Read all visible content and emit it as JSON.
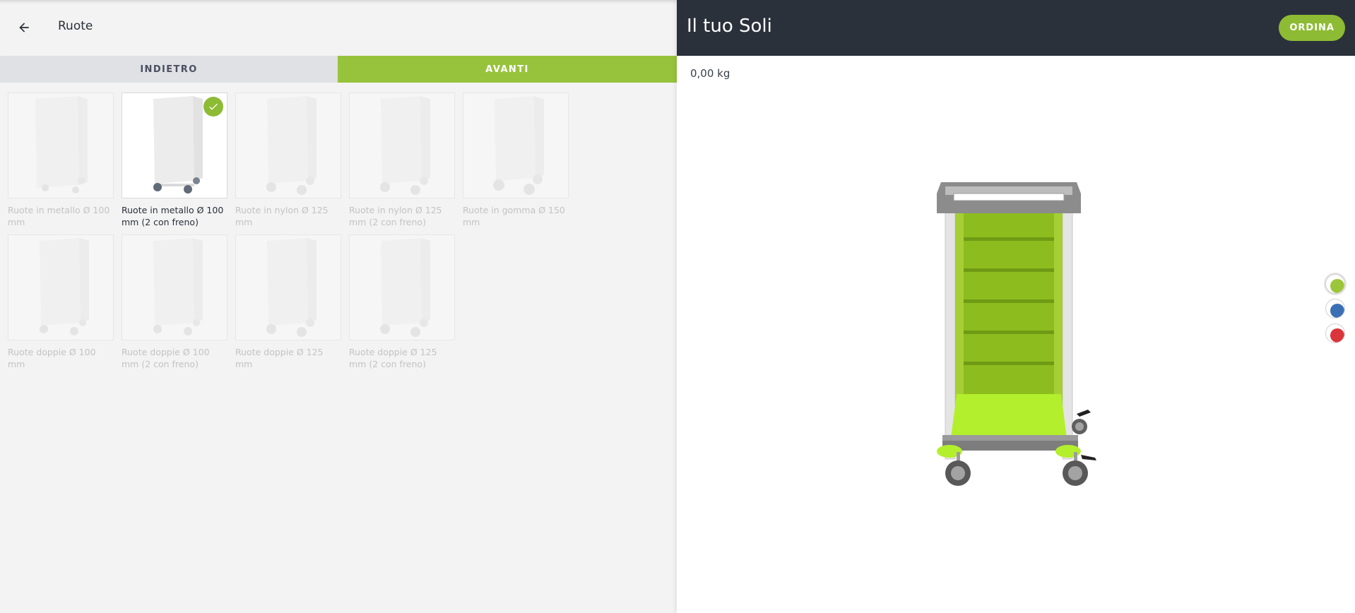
{
  "left_panel": {
    "back_icon": "arrow-left-icon",
    "title": "Ruote",
    "nav": {
      "back_label": "INDIETRO",
      "next_label": "AVANTI"
    },
    "options": [
      {
        "label": "Ruote in metallo Ø 100 mm",
        "selected": false
      },
      {
        "label": "Ruote in metallo Ø 100 mm (2 con freno)",
        "selected": true
      },
      {
        "label": "Ruote in nylon Ø 125 mm",
        "selected": false
      },
      {
        "label": "Ruote in nylon Ø 125 mm (2 con freno)",
        "selected": false
      },
      {
        "label": "Ruote in gomma Ø 150 mm",
        "selected": false
      },
      {
        "label": "Ruote doppie Ø 100 mm",
        "selected": false
      },
      {
        "label": "Ruote doppie Ø 100 mm (2 con freno)",
        "selected": false
      },
      {
        "label": "Ruote doppie Ø 125 mm",
        "selected": false
      },
      {
        "label": "Ruote doppie Ø 125 mm (2 con freno)",
        "selected": false
      }
    ],
    "selected_icon": "checkmark-icon"
  },
  "right_panel": {
    "title": "Il tuo Soli",
    "order_label": "ORDINA",
    "weight": "0,00 kg",
    "color_swatches": [
      {
        "name": "green",
        "color": "#9cc63a",
        "active": true
      },
      {
        "name": "blue",
        "color": "#3a6fb5",
        "active": false
      },
      {
        "name": "red",
        "color": "#d9353a",
        "active": false
      }
    ]
  },
  "colors": {
    "accent": "#97c33c",
    "header_dark": "#2b313b",
    "cart_green": "#8fbf2a"
  }
}
